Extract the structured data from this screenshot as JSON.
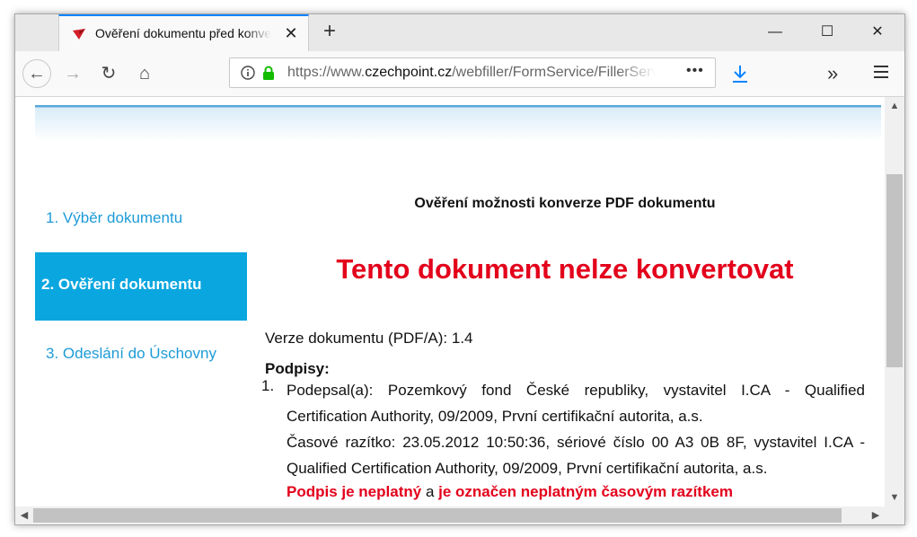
{
  "browser": {
    "tab": {
      "title": "Ověření dokumentu před konverzí",
      "close": "✕",
      "favicon": "czechpoint-favicon"
    },
    "new_tab": "+",
    "window_controls": {
      "minimize": "—",
      "maximize": "☐",
      "close": "✕"
    },
    "nav": {
      "back": "←",
      "forward": "→",
      "reload": "↻",
      "home": "⌂"
    },
    "url": {
      "prefix": "https://www.",
      "domain": "czechpoint.cz",
      "path": "/webfiller/FormService/FillerService"
    },
    "page_actions": "•••",
    "overflow": "»",
    "accent": "#0a84ff"
  },
  "sidebar": {
    "items": [
      {
        "label": "1. Výběr dokumentu",
        "active": false
      },
      {
        "label": "2. Ověření dokumentu",
        "active": true
      },
      {
        "label": "3. Odeslání do Úschovny",
        "active": false
      }
    ],
    "active_color": "#0aa6df",
    "link_color": "#1d9bd7"
  },
  "main": {
    "heading": "Ověření možnosti konverze PDF dokumentu",
    "result": "Tento dokument nelze konvertovat",
    "version_label": "Verze dokumentu (PDF/A):",
    "version_value": "1.4",
    "signatures_label": "Podpisy:",
    "signatures": [
      {
        "number": "1.",
        "signed_by_label": "Podepsal(a):",
        "signed_by": "Pozemkový fond České republiky, vystavitel I.CA - Qualified Certification Authority, 09/2009, První certifikační autorita, a.s.",
        "timestamp_label": "Časové razítko:",
        "timestamp": "23.05.2012 10:50:36, sériové číslo 00 A3 0B 8F, vystavitel I.CA - Qualified Certification Authority, 09/2009, První certifikační autorita, a.s.",
        "status_invalid": "Podpis je neplatný",
        "status_joiner": "a",
        "status_timestamp": "je označen neplatným časovým razítkem"
      }
    ],
    "error_color": "#e3001b"
  },
  "scrollbars": {
    "up": "▲",
    "down": "▼",
    "left": "◀",
    "right": "▶"
  }
}
